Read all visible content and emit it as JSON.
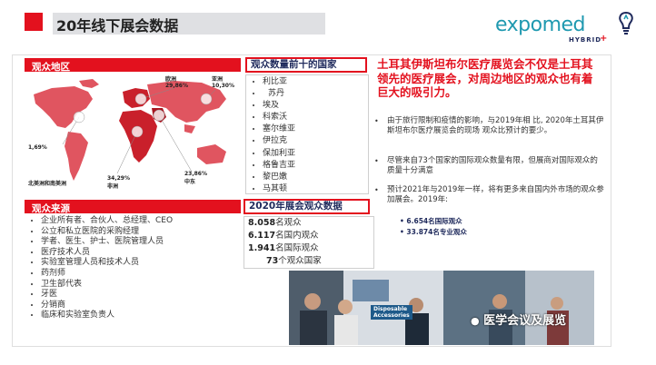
{
  "header": {
    "title": "20年线下展会数据",
    "logo_text": "expomed",
    "logo_sub": "HYBRID",
    "logo_plus": "+"
  },
  "colors": {
    "accent_red": "#e3111e",
    "navy": "#1f2a5c",
    "logo_teal": "#1f99b0"
  },
  "region_box": {
    "title": "观众地区",
    "labels": [
      {
        "region": "欧洲",
        "pct": "29,86%"
      },
      {
        "region": "亚洲",
        "pct": "10,30%"
      },
      {
        "region": "北美洲和南美洲",
        "pct": "1,69%"
      },
      {
        "region": "非洲",
        "pct": "34,29%"
      },
      {
        "region": "中东",
        "pct": "23,86%"
      }
    ]
  },
  "top10": {
    "title": "观众数量前十的国家",
    "items": [
      "利比亚",
      "苏丹",
      "埃及",
      "科索沃",
      "塞尔维亚",
      "伊拉克",
      "保加利亚",
      "格鲁吉亚",
      "黎巴嫩",
      "马其顿"
    ]
  },
  "source_box": {
    "title": "观众来源",
    "items": [
      "企业所有者、合伙人、总经理、CEO",
      "公立和私立医院的采购经理",
      "学者、医生、护士、医院管理人员",
      "医疗技术人员",
      "实验室管理人员和技术人员",
      "药剂师",
      "卫生部代表",
      "牙医",
      "分销商",
      "临床和实验室负责人"
    ]
  },
  "stats_box": {
    "title": "2020年展会观众数据",
    "rows": [
      {
        "num": "8.058",
        "text": "名观众"
      },
      {
        "num": "6.117",
        "text": "名国内观众"
      },
      {
        "num": "1.941",
        "text": "名国际观众"
      },
      {
        "num": "73",
        "text": "个观众国家"
      }
    ]
  },
  "right": {
    "headline": "土耳其伊斯坦布尔医疗展览会不仅是土耳其领先的医疗展会，对周边地区的观众也有着巨大的吸引力。",
    "bullets": [
      "由于旅行限制和疫情的影响，与2019年相 比, 2020年土耳其伊斯坦布尔医疗展览会的现场 观众比预计的要少。",
      "尽管来自73个国家的国际观众数量有限，但展商对国际观众的质量十分满意",
      "预计2021年与2019年一样，将有更多来自国内外市场的观众参加展会。2019年:"
    ],
    "sub_bullets": [
      "6.654名国际观众",
      "33.874名专业观众"
    ]
  },
  "photo": {
    "banner1": "Disposable",
    "banner2": "Accessories",
    "watermark": "医学会议及展览"
  }
}
